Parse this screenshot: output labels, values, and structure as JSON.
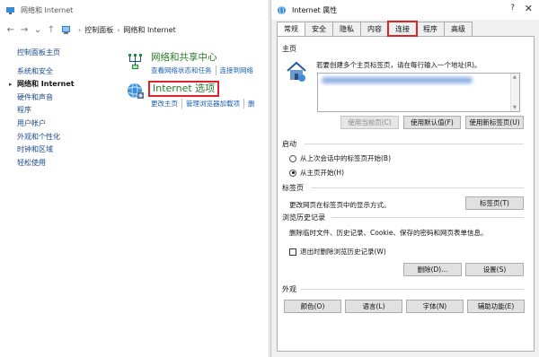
{
  "control_panel": {
    "window_title": "网络和 Internet",
    "nav": {
      "back": "←",
      "forward": "→",
      "dropdown": "⌄",
      "up": "↑"
    },
    "breadcrumb": [
      "控制面板",
      "网络和 Internet"
    ],
    "sidebar": {
      "home": "控制面板主页",
      "items": [
        "系统和安全",
        "网络和 Internet",
        "硬件和声音",
        "程序",
        "用户帐户",
        "外观和个性化",
        "时钟和区域",
        "轻松使用"
      ],
      "current_index": 1
    },
    "categories": [
      {
        "title": "网络和共享中心",
        "icon": "network-sharing-center-icon",
        "links": [
          "查看网络状态和任务",
          "连接到网络"
        ]
      },
      {
        "title": "Internet 选项",
        "icon": "internet-options-icon",
        "links": [
          "更改主页",
          "管理浏览器加载项",
          "删"
        ]
      }
    ]
  },
  "dialog": {
    "title": "Internet 属性",
    "help": "?",
    "close": "✕",
    "tabs": [
      "常规",
      "安全",
      "隐私",
      "内容",
      "连接",
      "程序",
      "高级"
    ],
    "active_tab_index": 0,
    "highlighted_tab_index": 4,
    "homepage": {
      "section_label": "主页",
      "hint": "若要创建多个主页标签页，请在每行输入一个地址(R)。",
      "buttons": {
        "use_current": "使用当前页(C)",
        "use_default": "使用默认值(F)",
        "use_new_tab": "使用新标签页(U)"
      }
    },
    "startup": {
      "section_label": "启动",
      "options": [
        "从上次会话中的标签页开始(B)",
        "从主页开始(H)"
      ],
      "selected_index": 1
    },
    "tabs_section": {
      "section_label": "标签页",
      "description": "更改网页在标签页中的显示方式。",
      "button": "标签页(T)"
    },
    "history": {
      "section_label": "浏览历史记录",
      "description": "删除临时文件、历史记录、Cookie、保存的密码和网页表单信息。",
      "checkbox_label": "退出时删除浏览历史记录(W)",
      "checkbox_checked": false,
      "buttons": {
        "delete": "删除(D)...",
        "settings": "设置(S)"
      }
    },
    "appearance": {
      "section_label": "外观",
      "buttons": [
        "颜色(O)",
        "语言(L)",
        "字体(N)",
        "辅助功能(E)"
      ]
    }
  },
  "colors": {
    "highlight_red": "#e0202a",
    "link_blue": "#1a5fb4",
    "category_green": "#2a7a2a",
    "dialog_bg": "#f0f0f0"
  }
}
